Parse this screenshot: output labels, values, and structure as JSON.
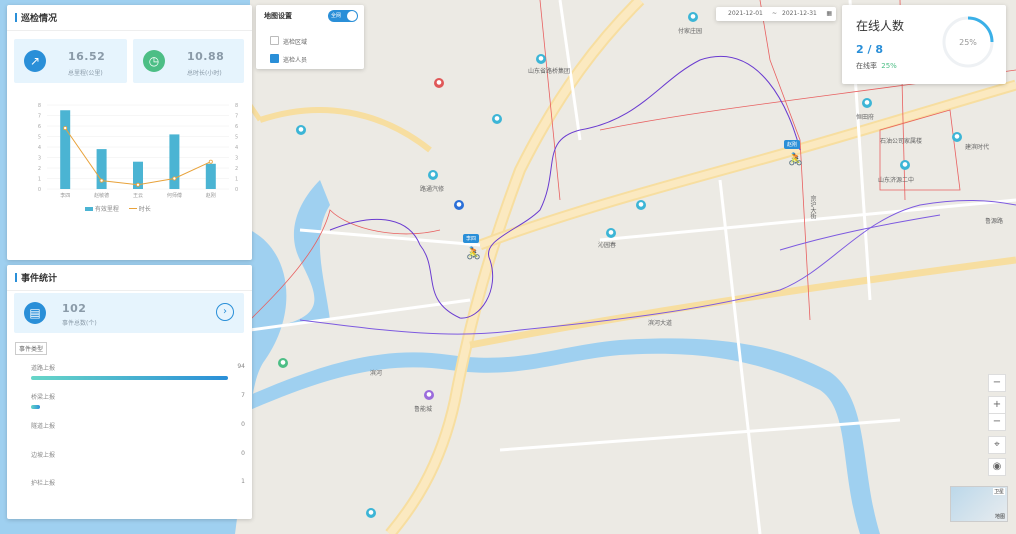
{
  "colors": {
    "accent": "#2a8fd8",
    "green": "#4cbe85",
    "bar": "#4bb4d3",
    "line": "#e8a23a"
  },
  "patrol": {
    "title": "巡检情况",
    "distance_value": "16.52",
    "distance_label": "总里程(公里)",
    "duration_value": "10.88",
    "duration_label": "总时长(小时)",
    "legend_distance": "有效里程",
    "legend_duration": "时长"
  },
  "chart_data": {
    "type": "bar",
    "categories": [
      "李四",
      "赵敏德",
      "王云",
      "何师傅",
      "赵刚"
    ],
    "series": [
      {
        "name": "有效里程",
        "type": "bar",
        "values": [
          7.5,
          3.8,
          2.6,
          5.2,
          2.4
        ]
      },
      {
        "name": "时长",
        "type": "line",
        "values": [
          5.8,
          0.8,
          0.4,
          1.0,
          2.6
        ]
      }
    ],
    "ylim": [
      0,
      8
    ],
    "y_ticks": [
      "0",
      "1",
      "2",
      "3",
      "4",
      "5",
      "6",
      "7",
      "8"
    ]
  },
  "events": {
    "title": "事件统计",
    "total_value": "102",
    "total_label": "事件总数(个)",
    "type_tag": "事件类型",
    "rows": [
      {
        "label": "道路上报",
        "value": "94",
        "fraction": 0.92
      },
      {
        "label": "桥梁上报",
        "value": "7",
        "fraction": 0.04
      },
      {
        "label": "隧道上报",
        "value": "0",
        "fraction": 0
      },
      {
        "label": "边坡上报",
        "value": "0",
        "fraction": 0
      },
      {
        "label": "护栏上报",
        "value": "1",
        "fraction": 0
      }
    ]
  },
  "map_settings": {
    "title": "地图设置",
    "toggle_label": "全网",
    "opt1": "巡检区域",
    "opt2": "巡检人员"
  },
  "date_range": {
    "start": "2021-12-01",
    "sep": "~",
    "end": "2021-12-31"
  },
  "online": {
    "title": "在线人数",
    "count": "2 / 8",
    "rate_label": "在线率",
    "rate_value": "25%",
    "gauge_text": "25%",
    "gauge_fraction": 0.25
  },
  "map_labels": {
    "l1": "付家庄园",
    "l2": "山东省路桥集团",
    "l3": "恒田府",
    "l4": "石油公司家属楼",
    "l5": "建滨时代",
    "l6": "山东济源二中",
    "l7": "鲁源路",
    "l8": "滨河",
    "l9": "路通汽修",
    "l10": "京沪大街",
    "l11": "沁园春",
    "l12": "鲁能城",
    "l13": "滨河大道",
    "rider1": "赵刚",
    "rider2": "李四",
    "thumb_label": "卫星",
    "thumb_label2": "地图"
  }
}
